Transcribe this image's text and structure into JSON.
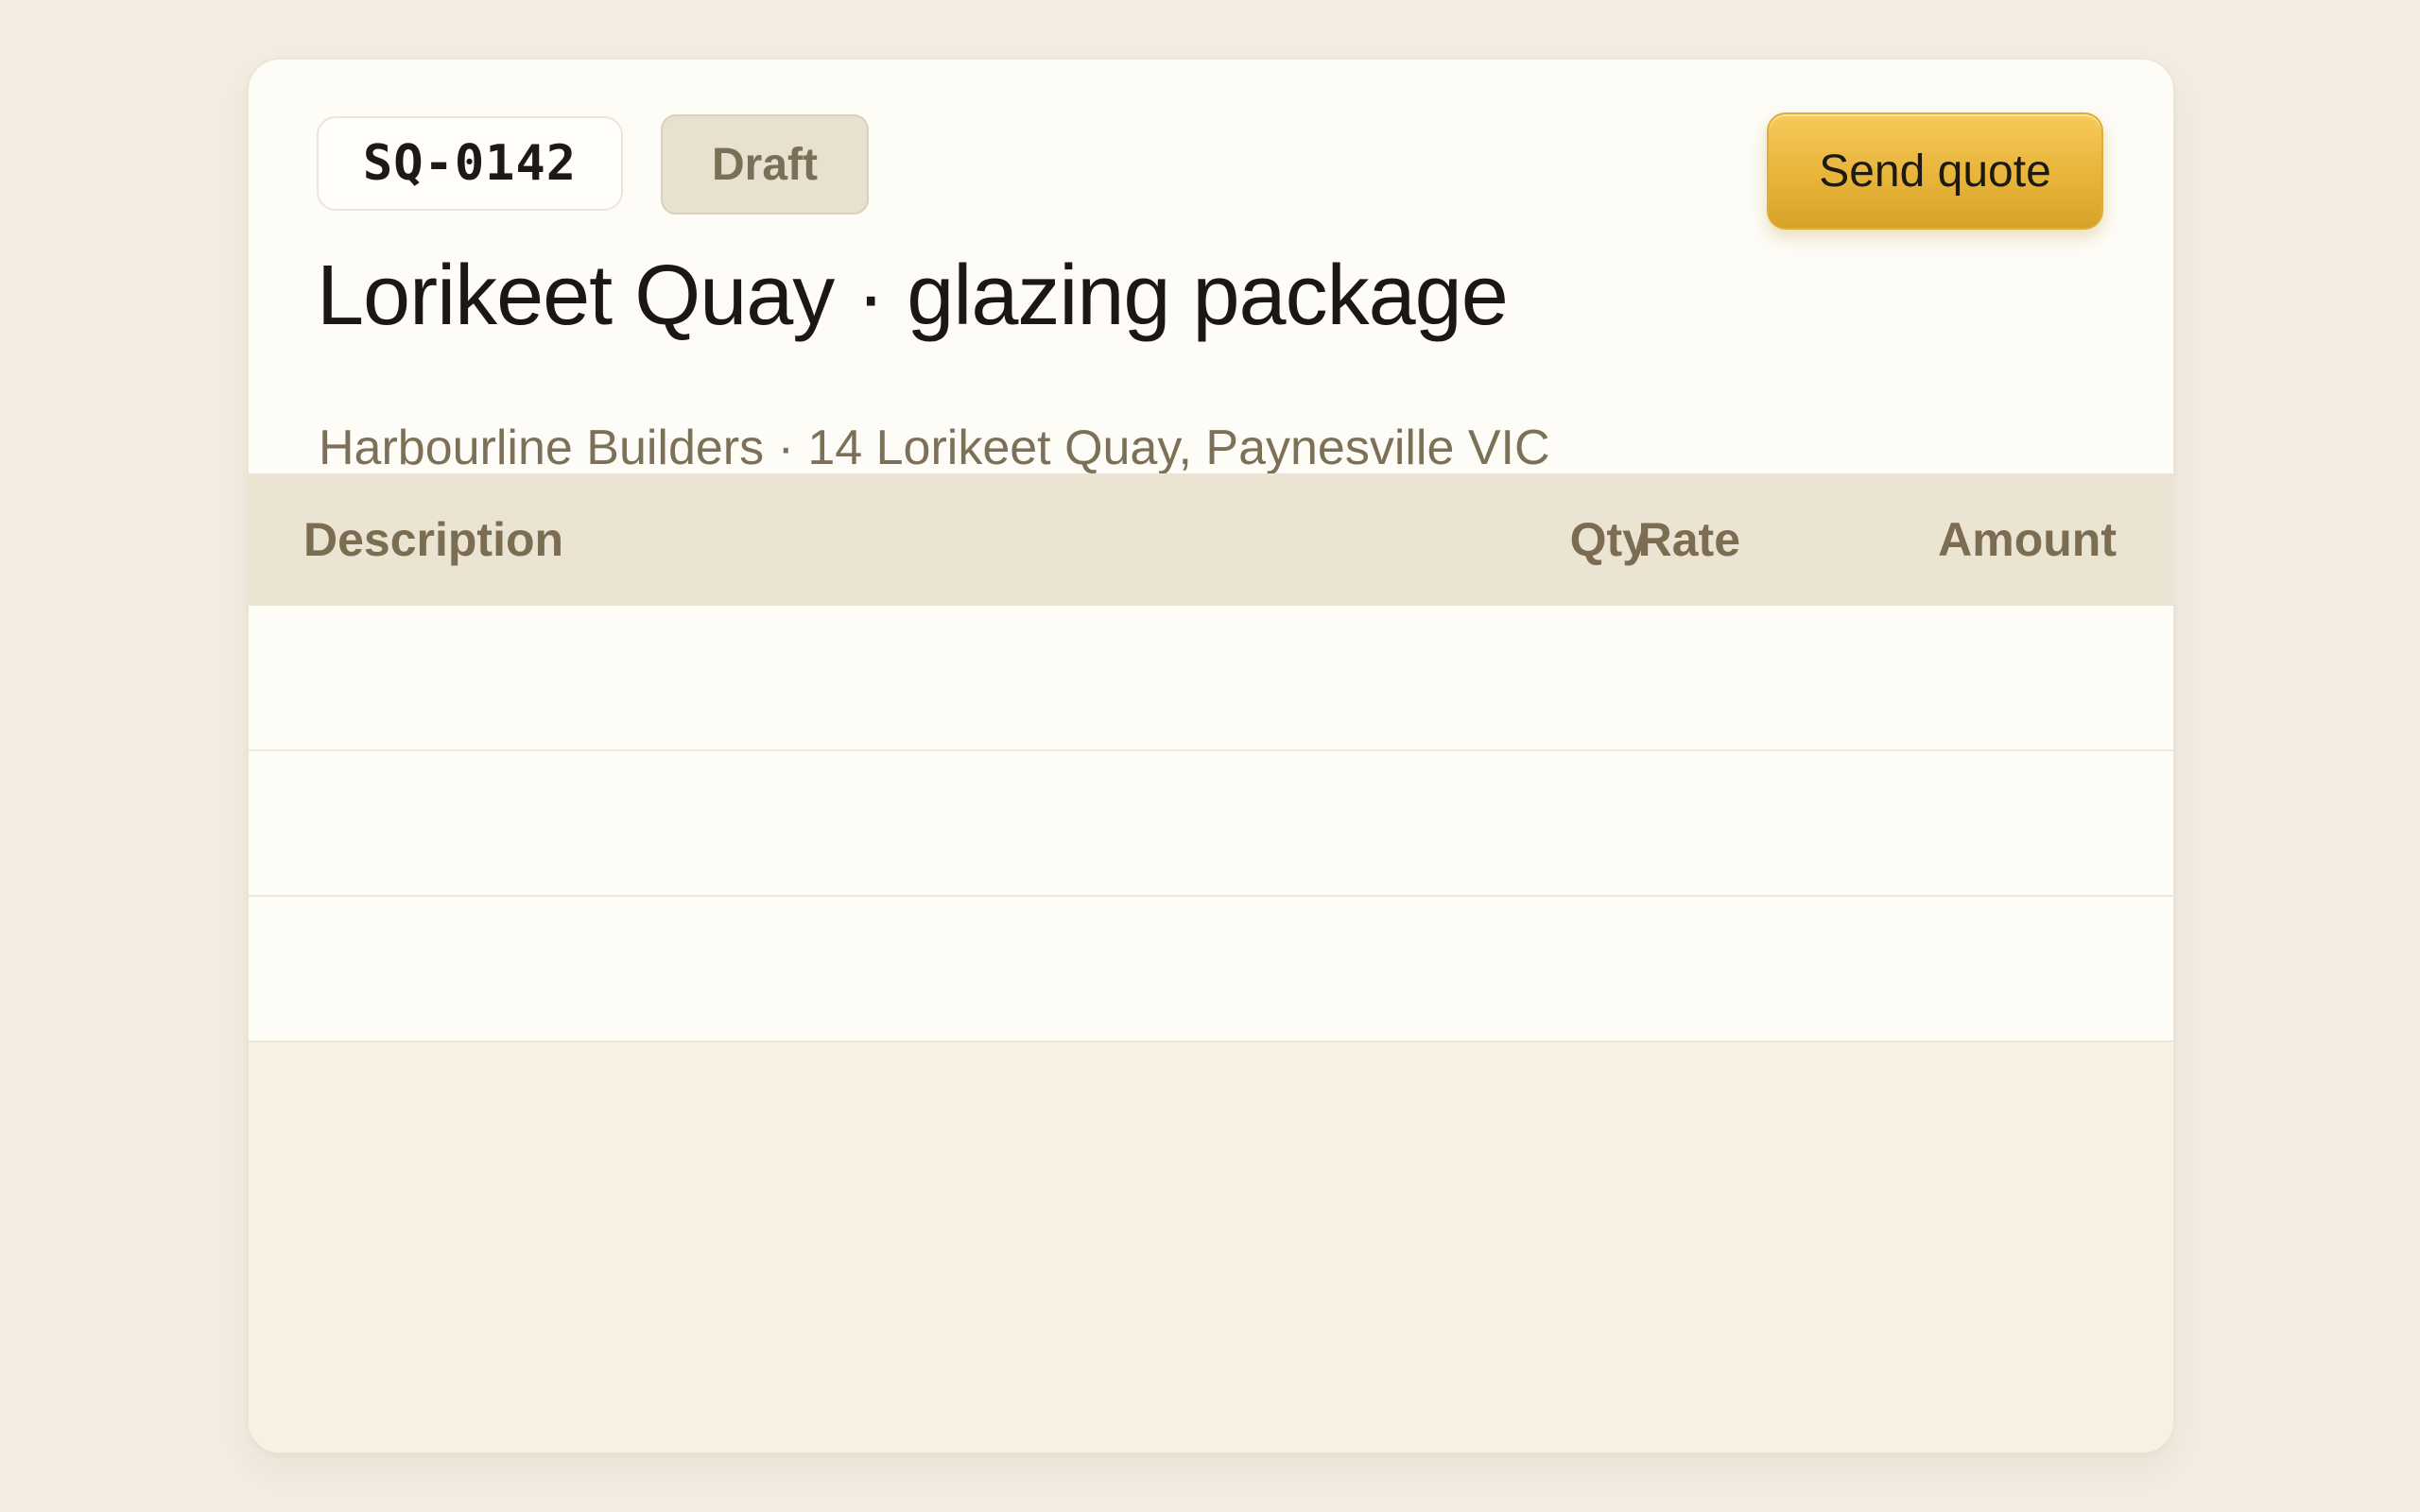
{
  "quote": {
    "id": "SQ-0142",
    "status": "Draft",
    "title": "Lorikeet Quay · glazing package",
    "subtitle": "Harbourline Builders · 14 Lorikeet Quay, Paynesville VIC"
  },
  "actions": {
    "send_label": "Send quote"
  },
  "table": {
    "columns": {
      "description": "Description",
      "qty": "Qty",
      "rate": "Rate",
      "amount": "Amount"
    },
    "rows": [
      {
        "description": "",
        "qty": "",
        "rate": "",
        "amount": ""
      },
      {
        "description": "",
        "qty": "",
        "rate": "",
        "amount": ""
      },
      {
        "description": "",
        "qty": "",
        "rate": "",
        "amount": ""
      }
    ]
  },
  "colors": {
    "background": "#f3ede2",
    "card": "#fdfcf7",
    "accent": "#e8b43a",
    "table_header": "#ece4d3",
    "footer": "#f8f1e1",
    "muted_text": "#7d7058"
  }
}
